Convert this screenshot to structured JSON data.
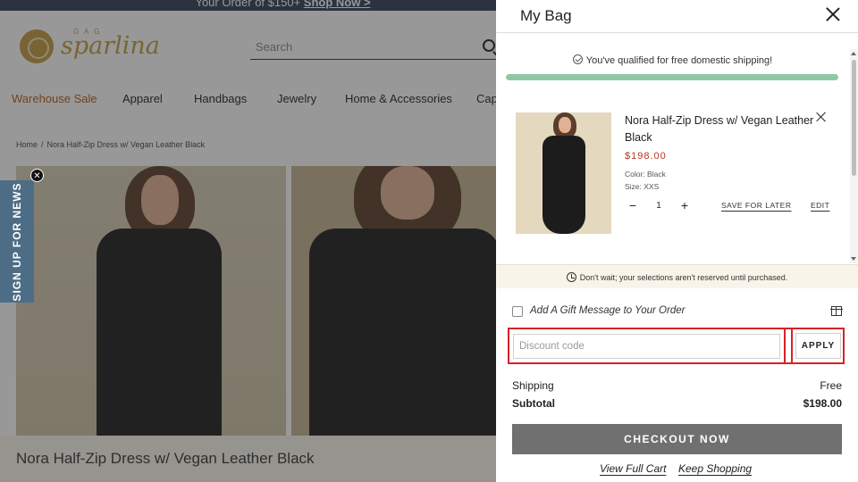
{
  "promo": {
    "text": "Your Order of $150+",
    "link": "Shop Now >"
  },
  "site": {
    "logo_text": "sparlina",
    "logo_sub": "G A G",
    "search_placeholder": "Search",
    "nav": [
      "Warehouse Sale",
      "Apparel",
      "Handbags",
      "Jewelry",
      "Home & Accessories",
      "Cap"
    ],
    "breadcrumb": [
      "Home",
      "Nora Half-Zip Dress w/ Vegan Leather Black"
    ],
    "signup": "SIGN UP FOR NEWS",
    "product_title": "Nora Half-Zip Dress w/ Vegan Leather Black"
  },
  "cart": {
    "title": "My Bag",
    "shipping_message": "You've qualified for free domestic shipping!",
    "shipping_progress": 1.0,
    "item": {
      "name": "Nora Half-Zip Dress w/ Vegan Leather Black",
      "price": "$198.00",
      "color": "Color: Black",
      "size": "Size: XXS",
      "qty_minus": "−",
      "quantity": "1",
      "qty_plus": "+",
      "save_for_later": "SAVE FOR LATER",
      "edit": "EDIT"
    },
    "notice": "Don't wait; your selections aren't reserved until purchased.",
    "gift_label": "Add A Gift Message to Your Order",
    "discount_placeholder": "Discount code",
    "apply_label": "APPLY",
    "shipping_label": "Shipping",
    "shipping_value": "Free",
    "subtotal_label": "Subtotal",
    "subtotal_value": "$198.00",
    "checkout_label": "CHECKOUT NOW",
    "view_cart": "View Full Cart",
    "keep_shopping": "Keep Shopping"
  },
  "colors": {
    "accent_nav": "#b35a16",
    "price": "#b6361d",
    "progress": "#8fc9a3",
    "highlight": "#d6222a",
    "checkout": "#707070"
  }
}
